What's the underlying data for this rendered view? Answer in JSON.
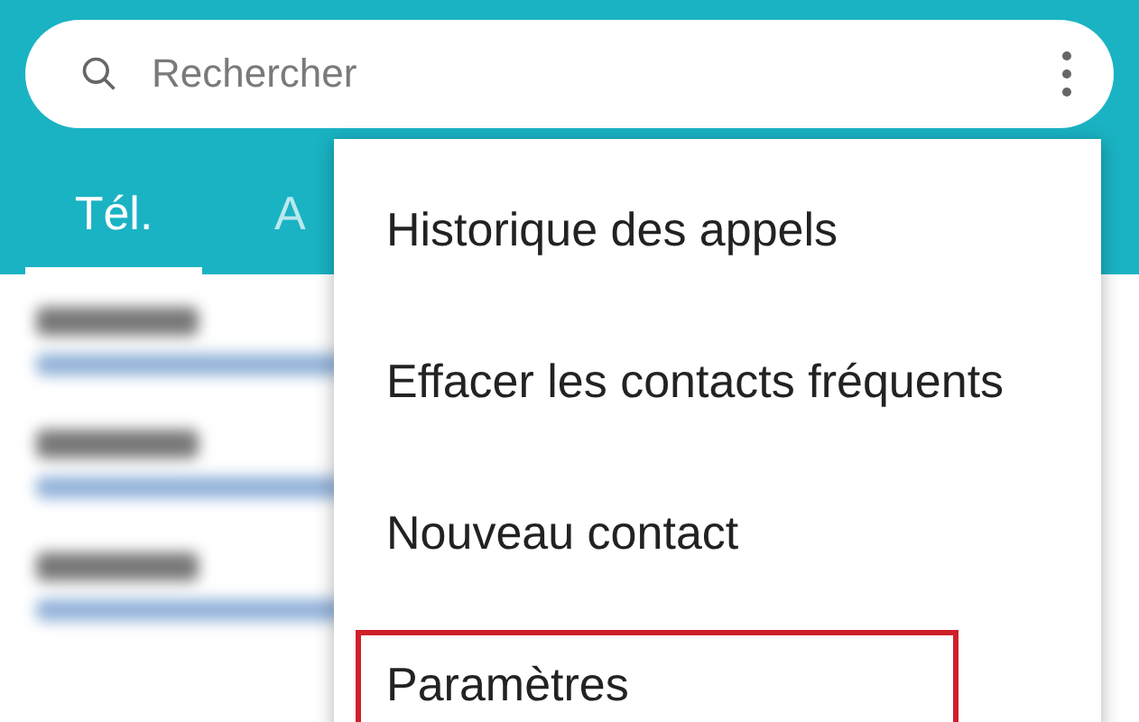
{
  "search": {
    "placeholder": "Rechercher"
  },
  "tabs": [
    {
      "label": "Tél.",
      "selected": true
    },
    {
      "label": "A",
      "selected": false
    }
  ],
  "contacts": [
    {
      "kind": "blurred"
    },
    {
      "kind": "blurred"
    },
    {
      "kind": "blurred"
    }
  ],
  "menu": [
    {
      "label": "Historique des appels",
      "highlighted": false
    },
    {
      "label": "Effacer les contacts fréquents",
      "highlighted": false
    },
    {
      "label": "Nouveau contact",
      "highlighted": false
    },
    {
      "label": "Paramètres",
      "highlighted": true
    }
  ]
}
